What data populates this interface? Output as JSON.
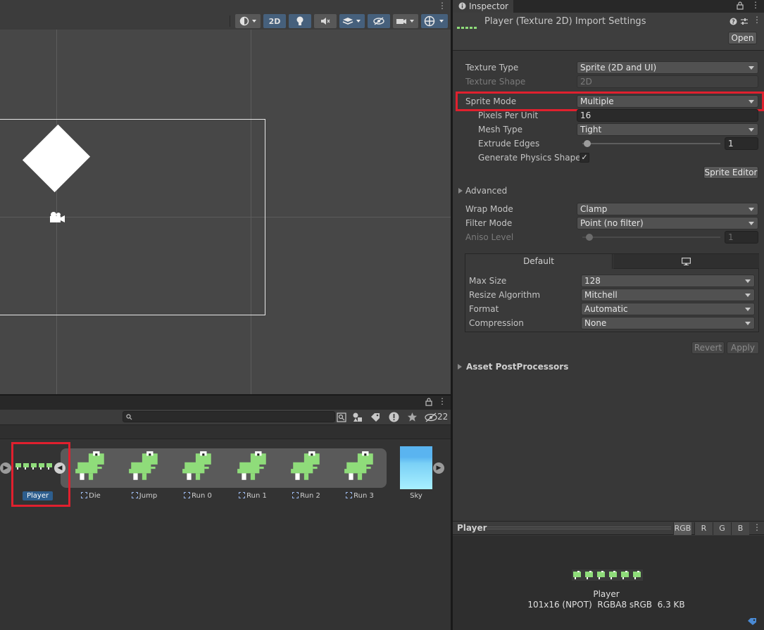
{
  "scene": {
    "toolbar": {
      "mode_2d_label": "2D"
    }
  },
  "project": {
    "hidden_count": "22",
    "assets": [
      {
        "name": "Player",
        "type": "sprite-sheet",
        "selected": true
      },
      {
        "name": "Die",
        "type": "sprite"
      },
      {
        "name": "Jump",
        "type": "sprite"
      },
      {
        "name": "Run 0",
        "type": "sprite"
      },
      {
        "name": "Run 1",
        "type": "sprite"
      },
      {
        "name": "Run 2",
        "type": "sprite"
      },
      {
        "name": "Run 3",
        "type": "sprite"
      },
      {
        "name": "Sky",
        "type": "texture"
      }
    ]
  },
  "inspector": {
    "tab_label": "Inspector",
    "title": "Player (Texture 2D) Import Settings",
    "open_label": "Open",
    "texture_type": {
      "label": "Texture Type",
      "value": "Sprite (2D and UI)"
    },
    "texture_shape": {
      "label": "Texture Shape",
      "value": "2D"
    },
    "sprite_mode": {
      "label": "Sprite Mode",
      "value": "Multiple"
    },
    "pixels_per_unit": {
      "label": "Pixels Per Unit",
      "value": "16"
    },
    "mesh_type": {
      "label": "Mesh Type",
      "value": "Tight"
    },
    "extrude_edges": {
      "label": "Extrude Edges",
      "value": "1"
    },
    "generate_physics_shape": {
      "label": "Generate Physics Shape",
      "checked": true
    },
    "sprite_editor_label": "Sprite Editor",
    "advanced_label": "Advanced",
    "wrap_mode": {
      "label": "Wrap Mode",
      "value": "Clamp"
    },
    "filter_mode": {
      "label": "Filter Mode",
      "value": "Point (no filter)"
    },
    "aniso_level": {
      "label": "Aniso Level",
      "value": "1"
    },
    "platform_tab_default": "Default",
    "max_size": {
      "label": "Max Size",
      "value": "128"
    },
    "resize_algorithm": {
      "label": "Resize Algorithm",
      "value": "Mitchell"
    },
    "format": {
      "label": "Format",
      "value": "Automatic"
    },
    "compression": {
      "label": "Compression",
      "value": "None"
    },
    "revert_label": "Revert",
    "apply_label": "Apply",
    "asset_postprocessors_label": "Asset PostProcessors"
  },
  "preview": {
    "title": "Player",
    "channels": [
      "RGB",
      "R",
      "G",
      "B"
    ],
    "asset_name": "Player",
    "info": "101x16 (NPOT)  RGBA8 sRGB  6.3 KB"
  },
  "colors": {
    "highlight": "#e0202e",
    "selected_label": "#2d5e8e",
    "dino_green": "#8fdc7a",
    "sky_top": "#5ab4f0",
    "sky_bottom": "#a8f0ff"
  }
}
